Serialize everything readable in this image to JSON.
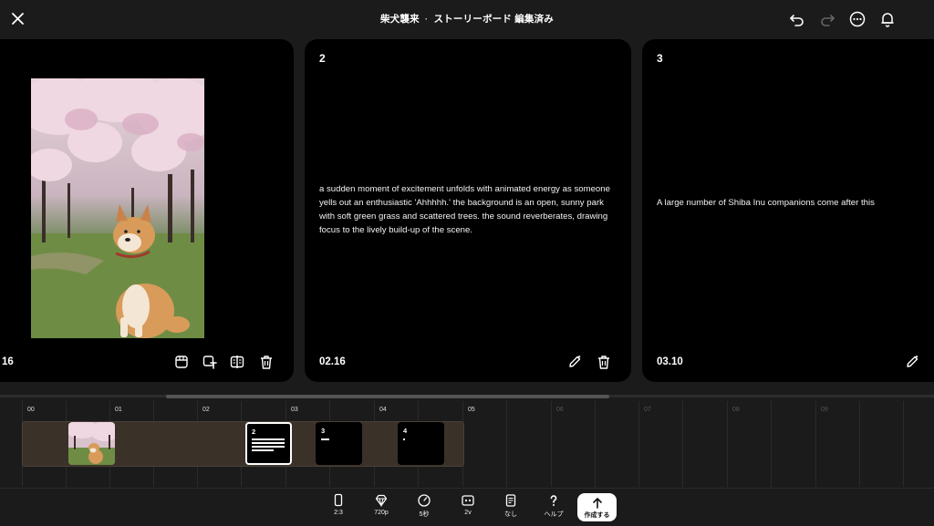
{
  "header": {
    "project": "柴犬襲来",
    "separator": "·",
    "status": "ストーリーボード 編集済み"
  },
  "cards": [
    {
      "time": "16"
    },
    {
      "number": "2",
      "text": "a sudden moment of excitement unfolds with animated energy as someone yells out an enthusiastic 'Ahhhhh.' the background is an open, sunny park with soft green grass and scattered trees. the sound reverberates, drawing focus to the lively build-up of the scene.",
      "time": "02.16"
    },
    {
      "number": "3",
      "text": "A large number of Shiba Inu companions come after this",
      "time": "03.10"
    }
  ],
  "timeline": {
    "ticks": [
      "00",
      "01",
      "02",
      "03",
      "04",
      "05",
      "06",
      "07",
      "08",
      "09"
    ],
    "clips": [
      {
        "number": "2"
      },
      {
        "number": "3"
      },
      {
        "number": "4"
      }
    ]
  },
  "toolbar": {
    "aspect": "2:3",
    "quality": "720p",
    "duration": "5秒",
    "version": "2v",
    "style": "なし",
    "help": "ヘルプ",
    "create": "作成する"
  },
  "colors": {
    "background": "#1b1b1b",
    "card": "#000000",
    "track": "#3a3129",
    "accent": "#ffffff"
  }
}
